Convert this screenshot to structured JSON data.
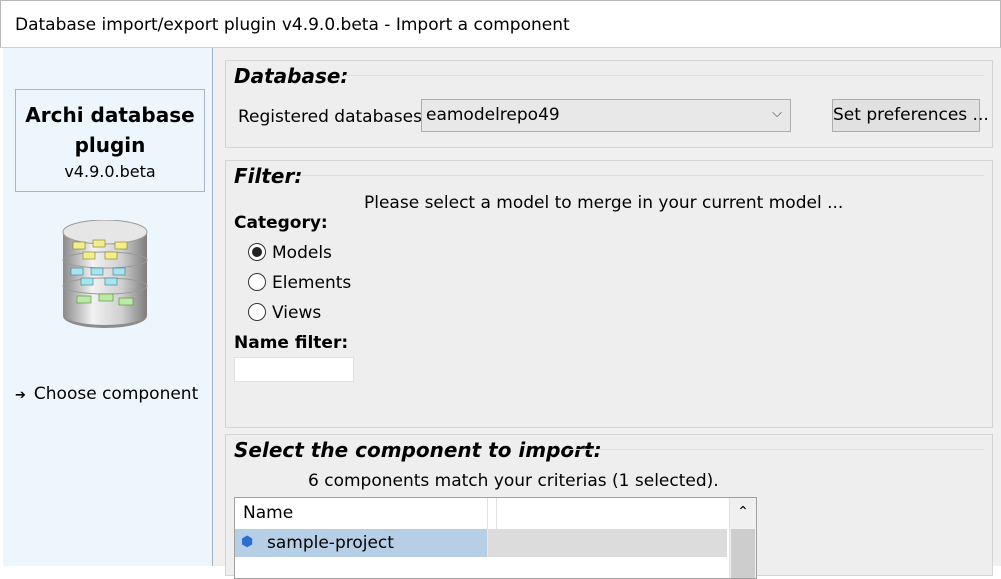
{
  "window": {
    "title": "Database import/export plugin v4.9.0.beta - Import a component"
  },
  "sidebar": {
    "plugin_name": "Archi database plugin",
    "plugin_version": "v4.9.0.beta",
    "steps": [
      {
        "label": "Choose component",
        "marker": "➔"
      }
    ],
    "icon": "database-icon"
  },
  "database_group": {
    "title": "Database:",
    "registered_label": "Registered databases:",
    "selected_database": "eamodelrepo49",
    "preferences_button": "Set preferences ..."
  },
  "filter_group": {
    "title": "Filter:",
    "hint": "Please select a model to merge in your current model ...",
    "category_label": "Category:",
    "categories": [
      {
        "label": "Models",
        "checked": true
      },
      {
        "label": "Elements",
        "checked": false
      },
      {
        "label": "Views",
        "checked": false
      }
    ],
    "name_filter_label": "Name filter:",
    "name_filter_value": ""
  },
  "component_group": {
    "title": "Select the component to import:",
    "match_text": "6 components match your criterias (1 selected).",
    "columns": [
      "Name",
      ""
    ],
    "rows": [
      {
        "name": "sample-project",
        "icon": "model-icon",
        "selected": true
      }
    ]
  },
  "colors": {
    "sidebar_bg": "#eef6fd",
    "selection": "#b6cfe7"
  }
}
